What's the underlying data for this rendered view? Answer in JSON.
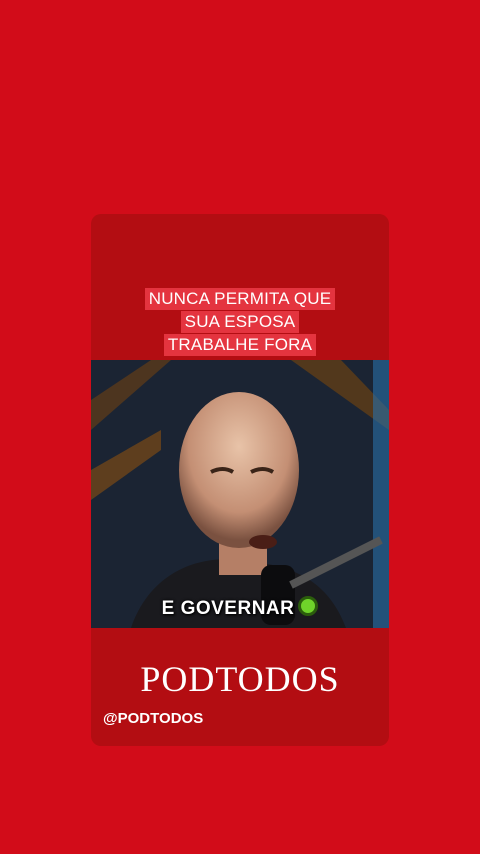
{
  "headline": {
    "line1": "NUNCA PERMITA QUE",
    "line2": "SUA ESPOSA",
    "line3": "TRABALHE FORA"
  },
  "video": {
    "caption": "E GOVERNAR"
  },
  "brand": "PODTODOS",
  "handle": "@PODTODOS",
  "colors": {
    "background": "#d20c19",
    "card": "#b30d12",
    "headline_highlight": "#e4343f",
    "caption_dot": "#6fd32a"
  }
}
